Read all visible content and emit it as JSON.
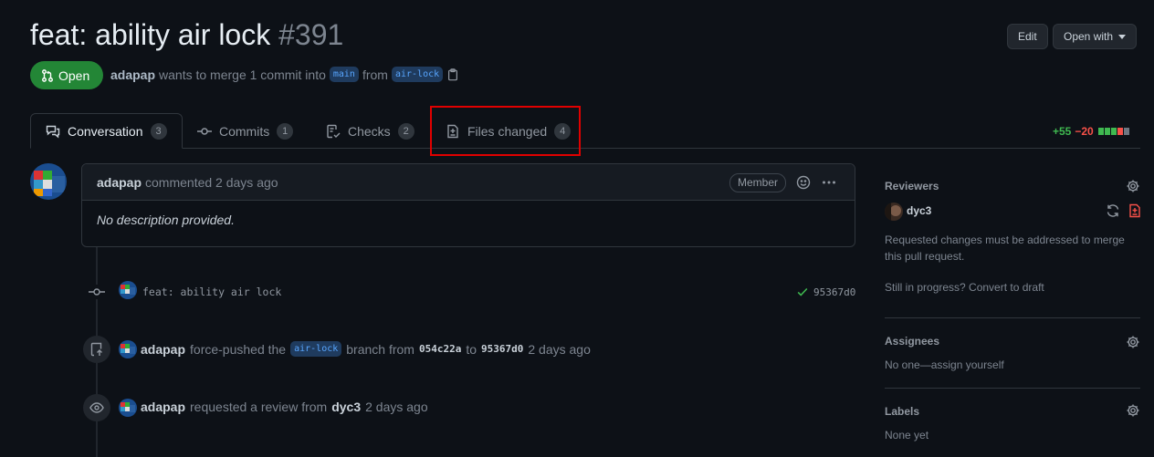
{
  "pr": {
    "title": "feat: ability air lock",
    "number": "#391",
    "state": "Open",
    "author": "adapap",
    "merge_text": "wants to merge 1 commit into",
    "base_branch": "main",
    "from_text": "from",
    "head_branch": "air-lock"
  },
  "header_buttons": {
    "edit": "Edit",
    "open_with": "Open with"
  },
  "tabs": [
    {
      "label": "Conversation",
      "count": "3"
    },
    {
      "label": "Commits",
      "count": "1"
    },
    {
      "label": "Checks",
      "count": "2"
    },
    {
      "label": "Files changed",
      "count": "4"
    }
  ],
  "diffstat": {
    "additions": "+55",
    "deletions": "−20"
  },
  "comment": {
    "author": "adapap",
    "meta": "commented 2 days ago",
    "badge": "Member",
    "body": "No description provided."
  },
  "timeline": {
    "commit": {
      "message": "feat: ability air lock",
      "sha": "95367d0"
    },
    "force_push": {
      "author": "adapap",
      "text1": "force-pushed the",
      "branch": "air-lock",
      "text2": "branch from",
      "from_sha": "054c22a",
      "text3": "to",
      "to_sha": "95367d0",
      "time": "2 days ago"
    },
    "review_request": {
      "author": "adapap",
      "text": "requested a review from",
      "reviewer": "dyc3",
      "time": "2 days ago"
    }
  },
  "sidebar": {
    "reviewers": {
      "heading": "Reviewers",
      "name": "dyc3",
      "note": "Requested changes must be addressed to merge this pull request.",
      "draft": "Still in progress? Convert to draft"
    },
    "assignees": {
      "heading": "Assignees",
      "value": "No one—assign yourself"
    },
    "labels": {
      "heading": "Labels",
      "value": "None yet"
    }
  },
  "colors": {
    "background": "#0d1117",
    "open_green": "#238636",
    "highlight_red": "#e00000",
    "addition": "#3fb950",
    "deletion": "#f85149"
  }
}
